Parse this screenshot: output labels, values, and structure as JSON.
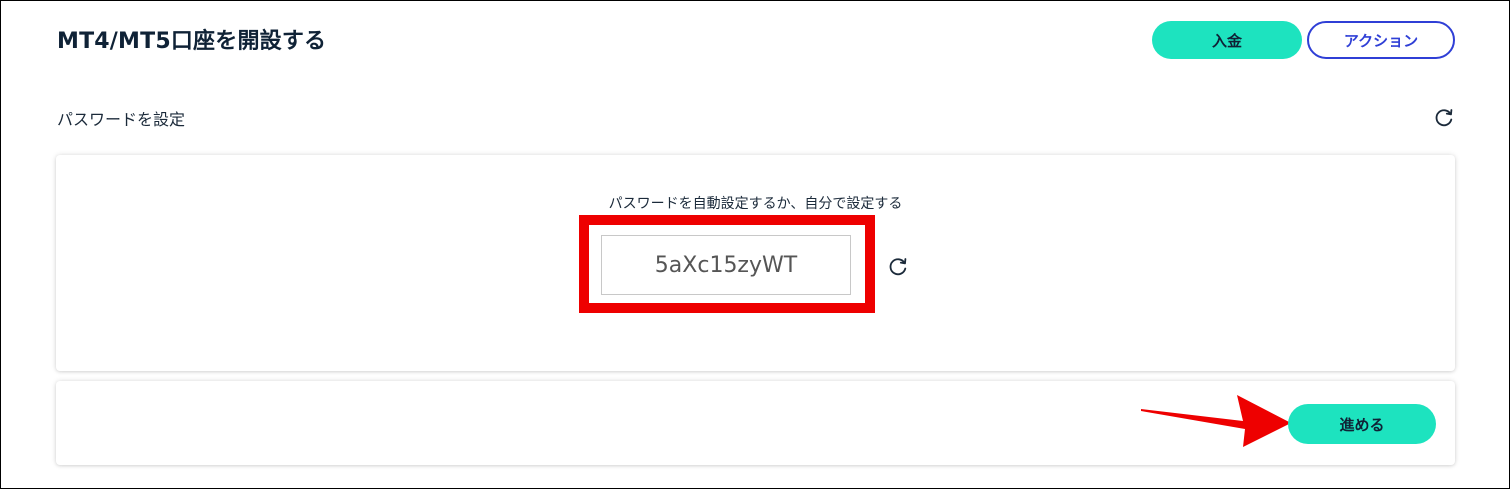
{
  "header": {
    "title": "MT4/MT5口座を開設する",
    "deposit_label": "入金",
    "action_label": "アクション"
  },
  "password_section": {
    "label": "パスワードを設定",
    "instruction": "パスワードを自動設定するか、自分で設定する",
    "password_value": "5aXc15zyWT"
  },
  "footer": {
    "next_label": "進める"
  },
  "colors": {
    "accent": "#1de3bf",
    "action_border": "#2f3fd6",
    "annotation_red": "#ee0000"
  },
  "icons": {
    "refresh": "refresh-icon",
    "annotation": "red-arrow-icon"
  }
}
